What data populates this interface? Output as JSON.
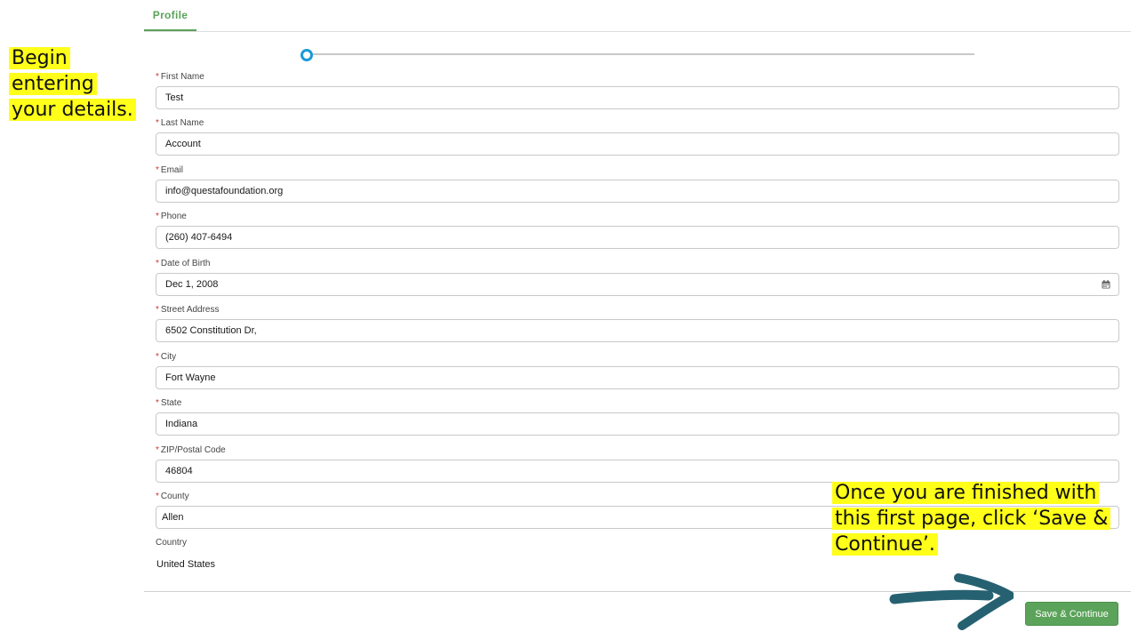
{
  "tabs": [
    {
      "label": "Profile"
    }
  ],
  "form": {
    "fields": [
      {
        "label": "First Name",
        "value": "Test",
        "required": true
      },
      {
        "label": "Last Name",
        "value": "Account",
        "required": true
      },
      {
        "label": "Email",
        "value": "info@questafoundation.org",
        "required": true
      },
      {
        "label": "Phone",
        "value": "(260) 407-6494",
        "required": true
      },
      {
        "label": "Date of Birth",
        "value": "Dec 1, 2008",
        "required": true,
        "icon": "calendar-icon"
      },
      {
        "label": "Street Address",
        "value": "6502 Constitution Dr,",
        "required": true
      },
      {
        "label": "City",
        "value": "Fort Wayne",
        "required": true
      },
      {
        "label": "State",
        "value": "Indiana",
        "required": true
      },
      {
        "label": "ZIP/Postal Code",
        "value": "46804",
        "required": true
      },
      {
        "label": "County",
        "value": "Allen",
        "required": true
      }
    ],
    "country": {
      "label": "Country",
      "value": "United States"
    },
    "required_marker": "*"
  },
  "footer": {
    "save_label": "Save & Continue"
  },
  "annotations": {
    "left_lines": [
      "Begin",
      "entering",
      "your details."
    ],
    "right_lines": [
      "Once you are finished with",
      "this first page, click ‘Save &",
      "Continue’."
    ]
  },
  "colors": {
    "accent": "#5ba35a",
    "progress": "#1a9ad8",
    "highlight": "#ffff1a",
    "arrow": "#266171",
    "required": "#c23934"
  }
}
